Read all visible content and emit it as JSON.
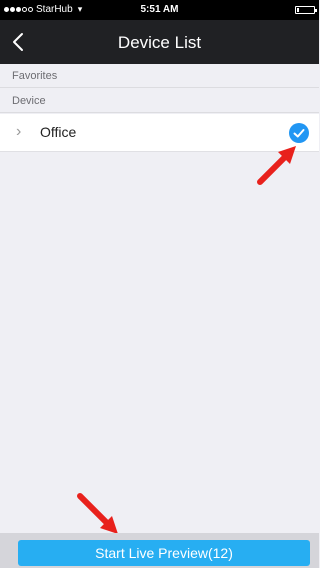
{
  "status_bar": {
    "carrier": "StarHub",
    "time": "5:51 AM",
    "battery_level": 0.15
  },
  "nav": {
    "title": "Device List",
    "back_icon": "chevron-left-icon"
  },
  "sections": {
    "favorites": "Favorites",
    "device": "Device"
  },
  "devices": [
    {
      "name": "Office",
      "selected": true
    }
  ],
  "bottom": {
    "button_label": "Start Live Preview(12)"
  },
  "colors": {
    "nav_background": "#202124",
    "accent": "#27aef2",
    "check": "#2196f3",
    "annotation_arrow": "#e8211c"
  }
}
